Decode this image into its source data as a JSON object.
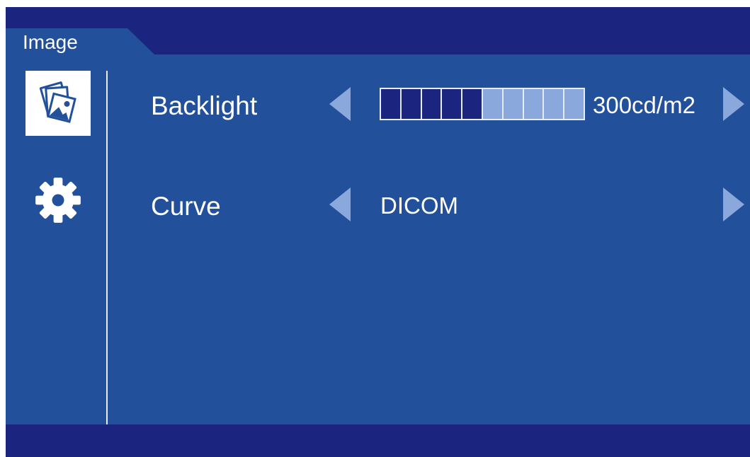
{
  "tab": {
    "label": "Image"
  },
  "sidebar": {
    "items": [
      {
        "name": "image",
        "icon": "images-icon",
        "active": true
      },
      {
        "name": "settings",
        "icon": "gear-icon",
        "active": false
      }
    ]
  },
  "menu": {
    "rows": [
      {
        "label": "Backlight",
        "control": "bar",
        "value": "300cd/m2",
        "level_fraction": 0.5,
        "segments_total": 10,
        "segments_filled": 5
      },
      {
        "label": "Curve",
        "control": "option",
        "value": "DICOM"
      }
    ]
  },
  "colors": {
    "panel": "#22509a",
    "frame": "#1b2580",
    "arrow": "#8aa8dc",
    "bar_filled": "#1b2580",
    "bar_empty": "#8aa8dc"
  }
}
